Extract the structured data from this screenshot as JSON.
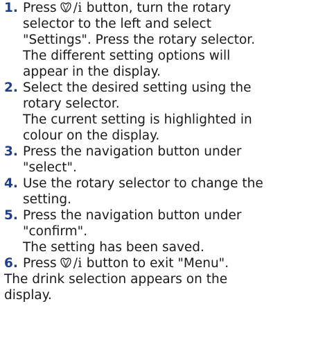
{
  "steps": [
    {
      "number": "1.",
      "pre": "Press",
      "icon": "drink-icon",
      "icon_suffix": "/i",
      "lines": [
        "button, turn the rotary",
        "selector to the left and select",
        "\"Settings\". Press the rotary selector.",
        "The different setting options will",
        "appear in the display."
      ]
    },
    {
      "number": "2.",
      "lines": [
        "Select the desired setting using the",
        "rotary selector.",
        "The current setting is highlighted in",
        "colour on the display."
      ]
    },
    {
      "number": "3.",
      "lines": [
        "Press the navigation button under",
        "\"select\"."
      ]
    },
    {
      "number": "4.",
      "lines": [
        "Use the rotary selector to change the",
        "setting."
      ]
    },
    {
      "number": "5.",
      "lines": [
        "Press the navigation button under",
        "\"confirm\".",
        "The setting has been saved."
      ]
    },
    {
      "number": "6.",
      "pre": "Press",
      "icon": "drink-icon",
      "icon_suffix": "/i",
      "lines": [
        "button to exit \"Menu\"."
      ]
    }
  ],
  "closing": [
    "The drink selection appears on the",
    "display."
  ],
  "colors": {
    "number": "#1f3f8c",
    "text": "#1a1a1a"
  }
}
